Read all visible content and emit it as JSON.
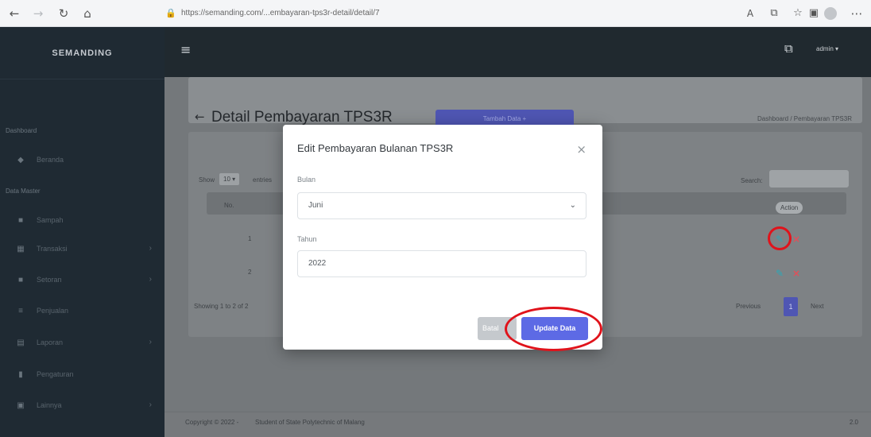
{
  "browser": {
    "url": "https://semanding.com/...embayaran-tps3r-detail/detail/7"
  },
  "sidebar": {
    "brand": "SEMANDING",
    "sections": [
      "Dashboard",
      "Data Master"
    ],
    "items": [
      {
        "label": "Beranda",
        "icon": "home-icon",
        "has_chevron": false
      },
      {
        "label": "Sampah",
        "icon": "trash-icon",
        "has_chevron": false
      },
      {
        "label": "Transaksi",
        "icon": "cart-icon",
        "has_chevron": true
      },
      {
        "label": "Setoran",
        "icon": "box-icon",
        "has_chevron": true
      },
      {
        "label": "Penjualan",
        "icon": "list-icon",
        "has_chevron": false
      },
      {
        "label": "Laporan",
        "icon": "doc-icon",
        "has_chevron": true
      },
      {
        "label": "Pengaturan",
        "icon": "file-icon",
        "has_chevron": false
      },
      {
        "label": "Lainnya",
        "icon": "menu-icon",
        "has_chevron": true
      }
    ]
  },
  "topbar": {
    "user": "admin"
  },
  "page": {
    "title": "Detail Pembayaran TPS3R",
    "add_button": "Tambah Data +",
    "breadcrumb": "Dashboard / Pembayaran TPS3R"
  },
  "table": {
    "show_label": "Show",
    "entries_value": "10",
    "entries_label": "entries",
    "search_label": "Search:",
    "col_no": "No.",
    "col_action": "Action",
    "rows": [
      {
        "no": "1"
      },
      {
        "no": "2"
      }
    ],
    "info": "Showing 1 to 2 of 2",
    "prev": "Previous",
    "page": "1",
    "next": "Next"
  },
  "footer": {
    "copyright": "Copyright © 2022 -",
    "org": "Student of State Polytechnic of Malang",
    "right": "2.0"
  },
  "modal": {
    "title": "Edit Pembayaran Bulanan TPS3R",
    "close_glyph": "×",
    "month_label": "Bulan",
    "month_value": "Juni",
    "year_label": "Tahun",
    "year_value": "2022",
    "close_button": "Batal",
    "update_button": "Update Data"
  },
  "annotations": {
    "color": "#e0131b"
  }
}
